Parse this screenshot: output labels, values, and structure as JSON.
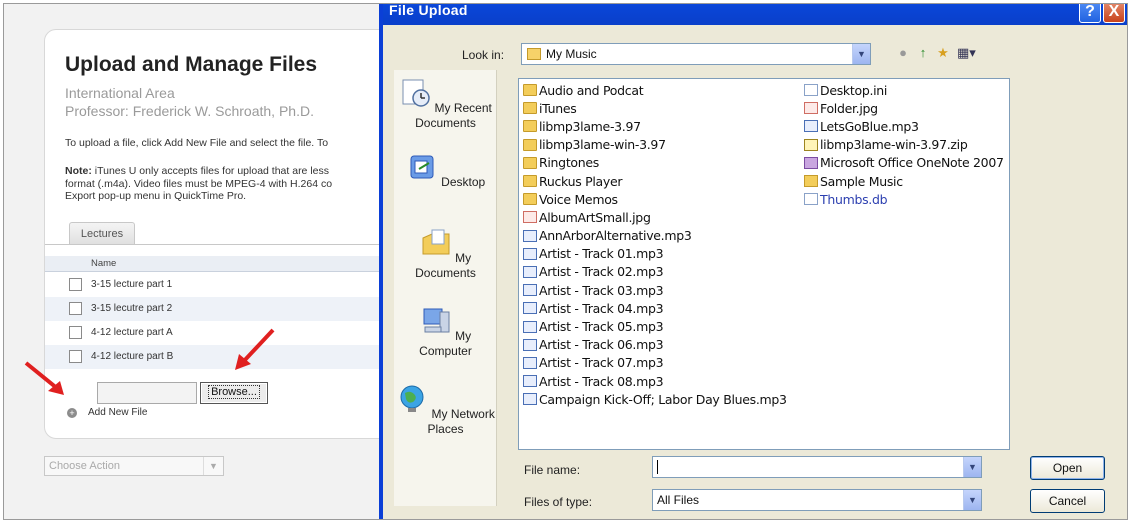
{
  "web_page": {
    "title": "Upload and Manage Files",
    "area": "International Area",
    "professor": "Professor: Frederick W. Schroath, Ph.D.",
    "instruction": "To upload a file, click Add New File and select the file. To",
    "note_bold": "Note:",
    "note_lines": [
      " iTunes U only accepts files for upload that are less",
      "format (.m4a). Video files must be MPEG-4 with H.264 co",
      "Export pop-up menu in QuickTime Pro."
    ],
    "tab_label": "Lectures",
    "list_header": "Name",
    "files": [
      "3-15 lecture part 1",
      "3-15 lecutre part 2",
      "4-12 lecture part A",
      "4-12 lecture part B"
    ],
    "browse_label": "Browse...",
    "add_new_file": "Add New File",
    "choose_action": "Choose Action"
  },
  "dialog": {
    "title": "File Upload",
    "look_in_label": "Look in:",
    "look_in_value": "My Music",
    "places": [
      "My Recent Documents",
      "Desktop",
      "My Documents",
      "My Computer",
      "My Network Places"
    ],
    "files_col1": [
      {
        "name": "Audio and Podcat",
        "type": "folder"
      },
      {
        "name": "iTunes",
        "type": "folder"
      },
      {
        "name": "libmp3lame-3.97",
        "type": "folder"
      },
      {
        "name": "libmp3lame-win-3.97",
        "type": "folder"
      },
      {
        "name": "Ringtones",
        "type": "folder"
      },
      {
        "name": "Ruckus Player",
        "type": "folder"
      },
      {
        "name": "Voice Memos",
        "type": "folder"
      },
      {
        "name": "AlbumArtSmall.jpg",
        "type": "img"
      },
      {
        "name": "AnnArborAlternative.mp3",
        "type": "mp3"
      },
      {
        "name": "Artist - Track 01.mp3",
        "type": "mp3"
      },
      {
        "name": "Artist - Track 02.mp3",
        "type": "mp3"
      },
      {
        "name": "Artist - Track 03.mp3",
        "type": "mp3"
      },
      {
        "name": "Artist - Track 04.mp3",
        "type": "mp3"
      },
      {
        "name": "Artist - Track 05.mp3",
        "type": "mp3"
      },
      {
        "name": "Artist - Track 06.mp3",
        "type": "mp3"
      },
      {
        "name": "Artist - Track 07.mp3",
        "type": "mp3"
      },
      {
        "name": "Artist - Track 08.mp3",
        "type": "mp3"
      },
      {
        "name": "Campaign Kick-Off; Labor Day Blues.mp3",
        "type": "mp3"
      }
    ],
    "files_col2": [
      {
        "name": "Desktop.ini",
        "type": "file"
      },
      {
        "name": "Folder.jpg",
        "type": "img"
      },
      {
        "name": "LetsGoBlue.mp3",
        "type": "mp3"
      },
      {
        "name": "libmp3lame-win-3.97.zip",
        "type": "zip"
      },
      {
        "name": "Microsoft Office OneNote 2007",
        "type": "note"
      },
      {
        "name": "Sample Music",
        "type": "music"
      },
      {
        "name": "Thumbs.db",
        "type": "file",
        "blue": true
      }
    ],
    "file_name_label": "File name:",
    "file_name_value": "",
    "files_of_type_label": "Files of type:",
    "files_of_type_value": "All Files",
    "open_label": "Open",
    "cancel_label": "Cancel",
    "help_label": "?",
    "close_label": "X"
  },
  "colors": {
    "titlebar": "#0a46d8",
    "annotation_arrow": "#e02020"
  }
}
